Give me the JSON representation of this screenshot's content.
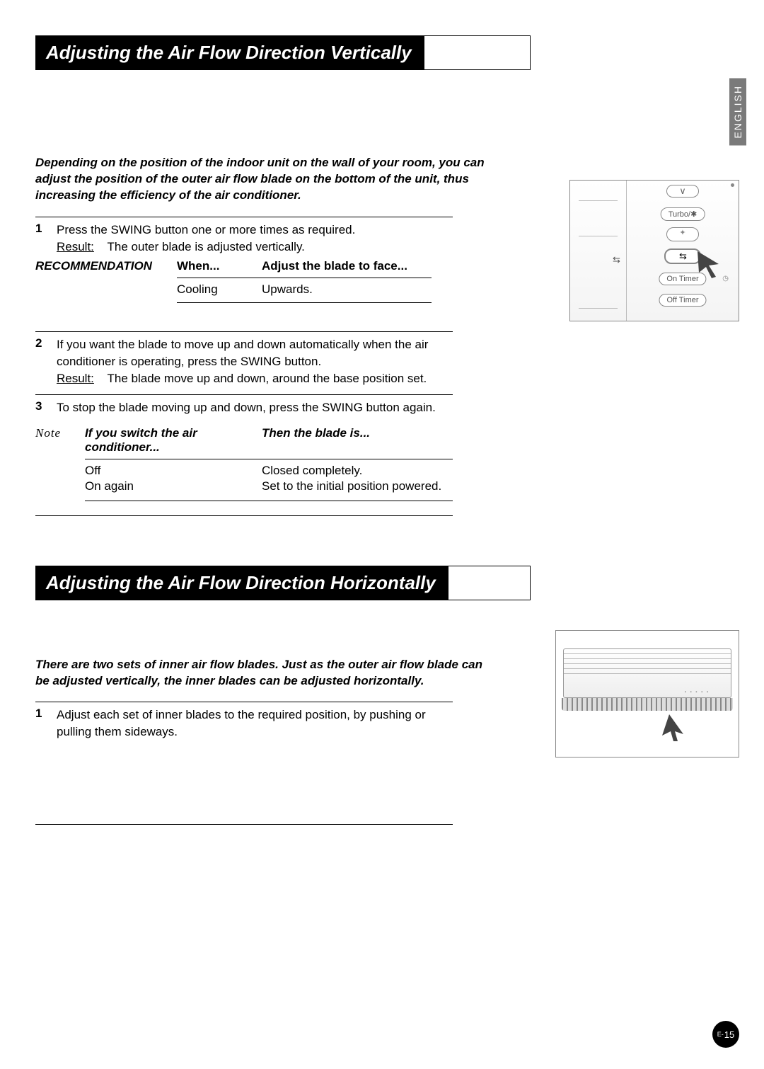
{
  "language_tab": "ENGLISH",
  "page_number_prefix": "E-",
  "page_number": "15",
  "section1": {
    "heading": "Adjusting the Air Flow Direction Vertically",
    "intro": "Depending on the position of the indoor unit on the wall of your room, you can adjust the position of the outer air flow blade on the bottom of the unit, thus increasing the efficiency of the air conditioner.",
    "step1": {
      "num": "1",
      "text": "Press the SWING button one or more times as required.",
      "result_label": "Result:",
      "result_text": "The outer blade is adjusted vertically."
    },
    "recommendation": {
      "label": "RECOMMENDATION",
      "head_when": "When...",
      "head_adjust": "Adjust the blade to face...",
      "when_val": "Cooling",
      "adjust_val": "Upwards."
    },
    "step2": {
      "num": "2",
      "text": "If you want the blade to move up and down automatically when the air conditioner is operating, press the SWING button.",
      "result_label": "Result:",
      "result_text": "The blade move up and down, around the base position set."
    },
    "step3": {
      "num": "3",
      "text": "To stop the blade moving up and down, press the SWING button again."
    },
    "note": {
      "label": "Note",
      "head_if": "If you switch the air conditioner...",
      "head_then": "Then the blade is...",
      "rows": [
        {
          "c1": "Off",
          "c2": "Closed completely."
        },
        {
          "c1": "On again",
          "c2": "Set to the initial position powered."
        }
      ]
    }
  },
  "section2": {
    "heading": "Adjusting the Air Flow Direction Horizontally",
    "intro": "There are two sets of inner air flow blades. Just as the outer air flow blade can be adjusted vertically, the inner blades can be adjusted horizontally.",
    "step1": {
      "num": "1",
      "text": "Adjust each set of inner blades to the required position, by pushing or pulling them sideways."
    }
  },
  "remote": {
    "turbo_label": "Turbo/",
    "on_timer": "On Timer",
    "off_timer": "Off Timer"
  }
}
